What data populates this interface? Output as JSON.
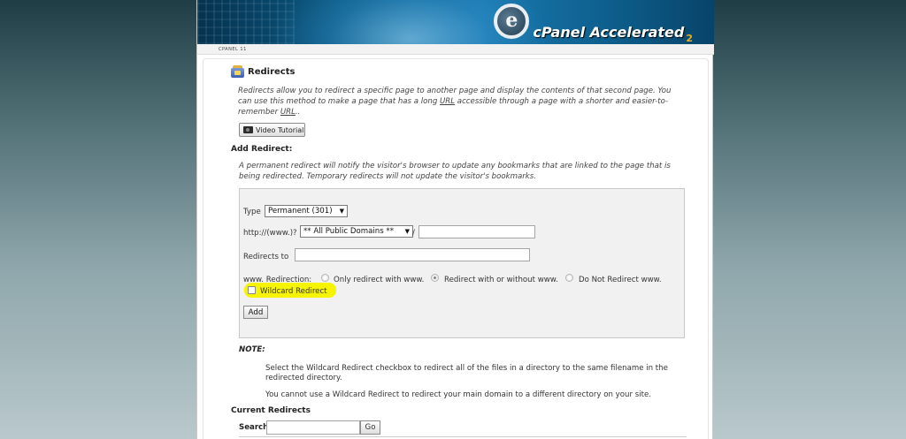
{
  "header": {
    "brand_prefix": "cPanel",
    "brand_main": "Accelerated",
    "brand_version": "2",
    "breadcrumb": "CPANEL 11"
  },
  "page": {
    "title": "Redirects",
    "intro_before_url1": "Redirects allow you to redirect a specific page to another page and display the contents of that second page. You can use this method to make a page that has a long ",
    "intro_url1": "URL",
    "intro_middle": " accessible through a page with a shorter and easier-to-remember ",
    "intro_url2": "URL",
    "intro_end": "..",
    "video_tutorial_label": "Video Tutorial"
  },
  "add_redirect": {
    "heading": "Add Redirect:",
    "description": "A permanent redirect will notify the visitor's browser to update any bookmarks that are linked to the page that is being redirected. Temporary redirects will not update the visitor's bookmarks.",
    "type_label": "Type",
    "type_value": "Permanent (301)",
    "url_prefix_label": "http://(www.)?",
    "domain_value": "** All Public Domains **",
    "slash": "/",
    "path_value": "",
    "redirects_to_label": "Redirects to",
    "redirects_to_value": "",
    "www_label": "www. Redirection:",
    "www_options": [
      {
        "label": "Only redirect with www.",
        "selected": false
      },
      {
        "label": "Redirect with or without www.",
        "selected": true
      },
      {
        "label": "Do Not Redirect www.",
        "selected": false
      }
    ],
    "wildcard_label": "Wildcard Redirect",
    "wildcard_checked": false,
    "highlight_color": "#f6f400",
    "add_button_label": "Add"
  },
  "note": {
    "heading": "NOTE:",
    "line1": "Select the Wildcard Redirect checkbox to redirect all of the files in a directory to the same filename in the redirected directory.",
    "line2": "You cannot use a Wildcard Redirect to redirect your main domain to a different directory on your site."
  },
  "current_redirects": {
    "heading": "Current Redirects",
    "search_label": "Search",
    "search_value": "",
    "go_label": "Go"
  }
}
